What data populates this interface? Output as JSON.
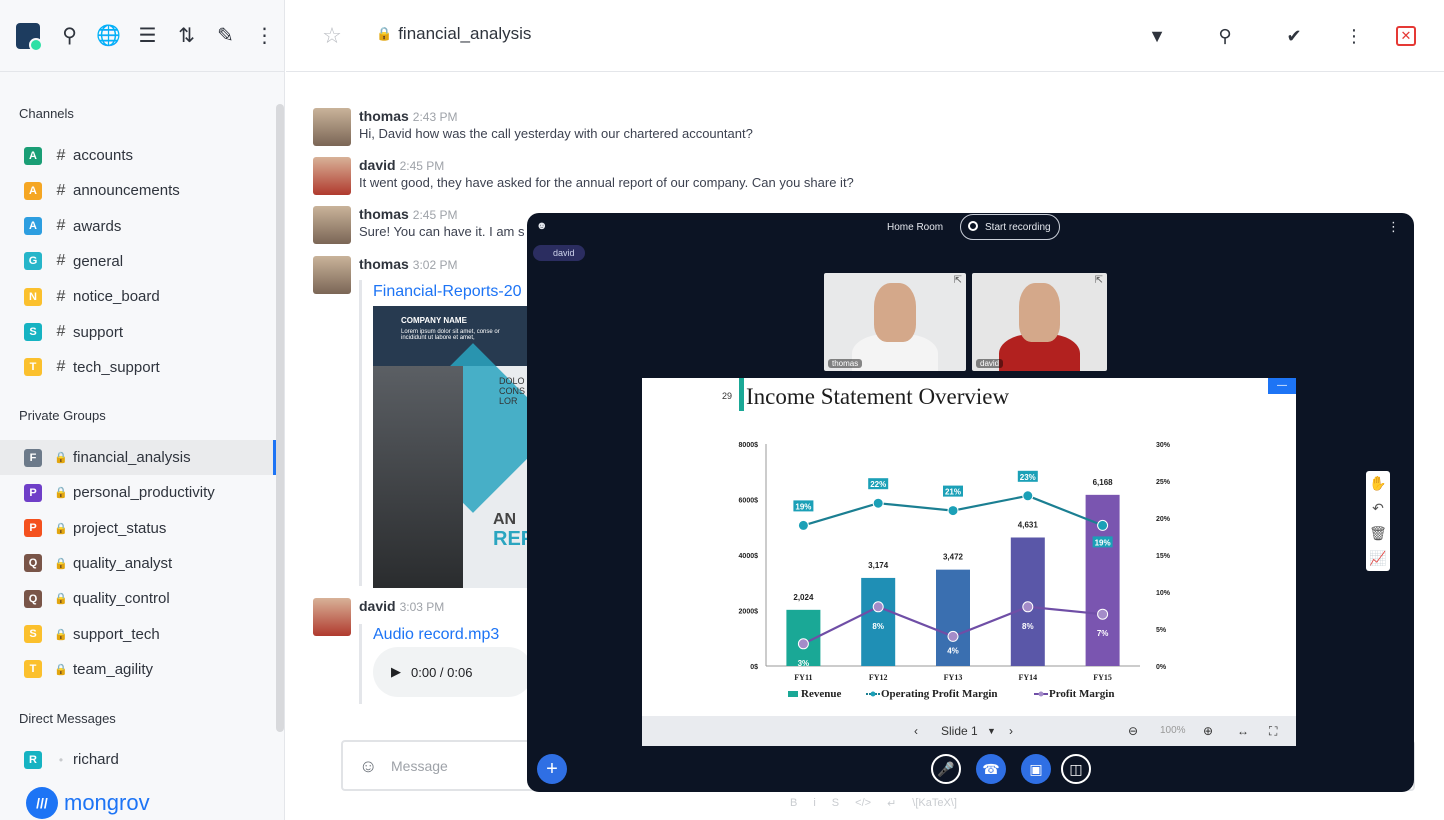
{
  "sidebar": {
    "sections": {
      "channels": "Channels",
      "private": "Private Groups",
      "direct": "Direct Messages"
    },
    "channels": [
      {
        "badge": "A",
        "color": "#1a9e75",
        "name": "accounts"
      },
      {
        "badge": "A",
        "color": "#f5a623",
        "name": "announcements"
      },
      {
        "badge": "A",
        "color": "#2d9ee0",
        "name": "awards"
      },
      {
        "badge": "G",
        "color": "#26b5c9",
        "name": "general"
      },
      {
        "badge": "N",
        "color": "#fbc02d",
        "name": "notice_board"
      },
      {
        "badge": "S",
        "color": "#16b3c2",
        "name": "support"
      },
      {
        "badge": "T",
        "color": "#fbc02d",
        "name": "tech_support"
      }
    ],
    "private_groups": [
      {
        "badge": "F",
        "color": "#6c7a8a",
        "name": "financial_analysis"
      },
      {
        "badge": "P",
        "color": "#6f3fc8",
        "name": "personal_productivity"
      },
      {
        "badge": "P",
        "color": "#f4511e",
        "name": "project_status"
      },
      {
        "badge": "Q",
        "color": "#795548",
        "name": "quality_analyst"
      },
      {
        "badge": "Q",
        "color": "#795548",
        "name": "quality_control"
      },
      {
        "badge": "S",
        "color": "#fbc02d",
        "name": "support_tech"
      },
      {
        "badge": "T",
        "color": "#fbc02d",
        "name": "team_agility"
      }
    ],
    "direct": [
      {
        "badge": "R",
        "color": "#16b3c2",
        "name": "richard"
      }
    ],
    "brand": "mongrov"
  },
  "header": {
    "room": "financial_analysis"
  },
  "messages": [
    {
      "user": "thomas",
      "time": "2:43 PM",
      "text": "Hi, David how was the call yesterday with our chartered accountant?"
    },
    {
      "user": "david",
      "time": "2:45 PM",
      "text": "It went good, they have asked for the annual report of our company. Can you share it?"
    },
    {
      "user": "thomas",
      "time": "2:45 PM",
      "text": "Sure! You can have it. I am s"
    },
    {
      "user": "thomas",
      "time": "3:02 PM",
      "attachment": "Financial-Reports-20"
    },
    {
      "user": "david",
      "time": "3:03 PM",
      "attachment": "Audio record.mp3"
    }
  ],
  "doc": {
    "company": "COMPANY NAME",
    "lorem": "Lorem ipsum dolor sit amet, conse or incididunt ut labore et amet,",
    "side": "DOLO CONS LOR",
    "big1": "AN",
    "big2": "REP"
  },
  "audio": {
    "time": "0:00 / 0:06"
  },
  "composer": {
    "placeholder": "Message",
    "fmt": [
      "B",
      "i",
      "S",
      "</>",
      "↵",
      "\\[KaTeX\\]"
    ]
  },
  "call": {
    "room": "Home Room",
    "record": "Start recording",
    "user_pill": "david",
    "tiles": [
      "thomas",
      "david"
    ],
    "slide_number": "29",
    "slide_title": "Income Statement Overview",
    "slide_label": "Slide 1",
    "zoom": "100%"
  },
  "chart_data": {
    "type": "bar",
    "title": "Income Statement Overview",
    "categories": [
      "FY11",
      "FY12",
      "FY13",
      "FY14",
      "FY15"
    ],
    "series": [
      {
        "name": "Revenue",
        "type": "bar",
        "values": [
          2024,
          3174,
          3472,
          4631,
          6168
        ],
        "colors": [
          "#1aa896",
          "#1f8fb5",
          "#3a6fb0",
          "#5a57a8",
          "#7a55b0"
        ]
      },
      {
        "name": "Operating Profit Margin",
        "type": "line",
        "axis": "right",
        "values": [
          19,
          22,
          21,
          23,
          19
        ],
        "color": "#1b7f92"
      },
      {
        "name": "Profit Margin",
        "type": "line",
        "axis": "right",
        "values": [
          3,
          8,
          4,
          8,
          7
        ],
        "color": "#6f4ea6"
      }
    ],
    "ylim_left": [
      0,
      8000
    ],
    "yticks_left": [
      "0$",
      "2000$",
      "4000$",
      "6000$",
      "8000$"
    ],
    "ylim_right": [
      0,
      30
    ],
    "yticks_right": [
      "0%",
      "5%",
      "10%",
      "15%",
      "20%",
      "25%",
      "30%"
    ],
    "bar_labels": [
      "2,024",
      "3,174",
      "3,472",
      "4,631",
      "6,168"
    ],
    "op_labels": [
      "19%",
      "22%",
      "21%",
      "23%",
      "19%"
    ],
    "pm_labels": [
      "3%",
      "8%",
      "4%",
      "8%",
      "7%"
    ],
    "legend": "bottom"
  }
}
